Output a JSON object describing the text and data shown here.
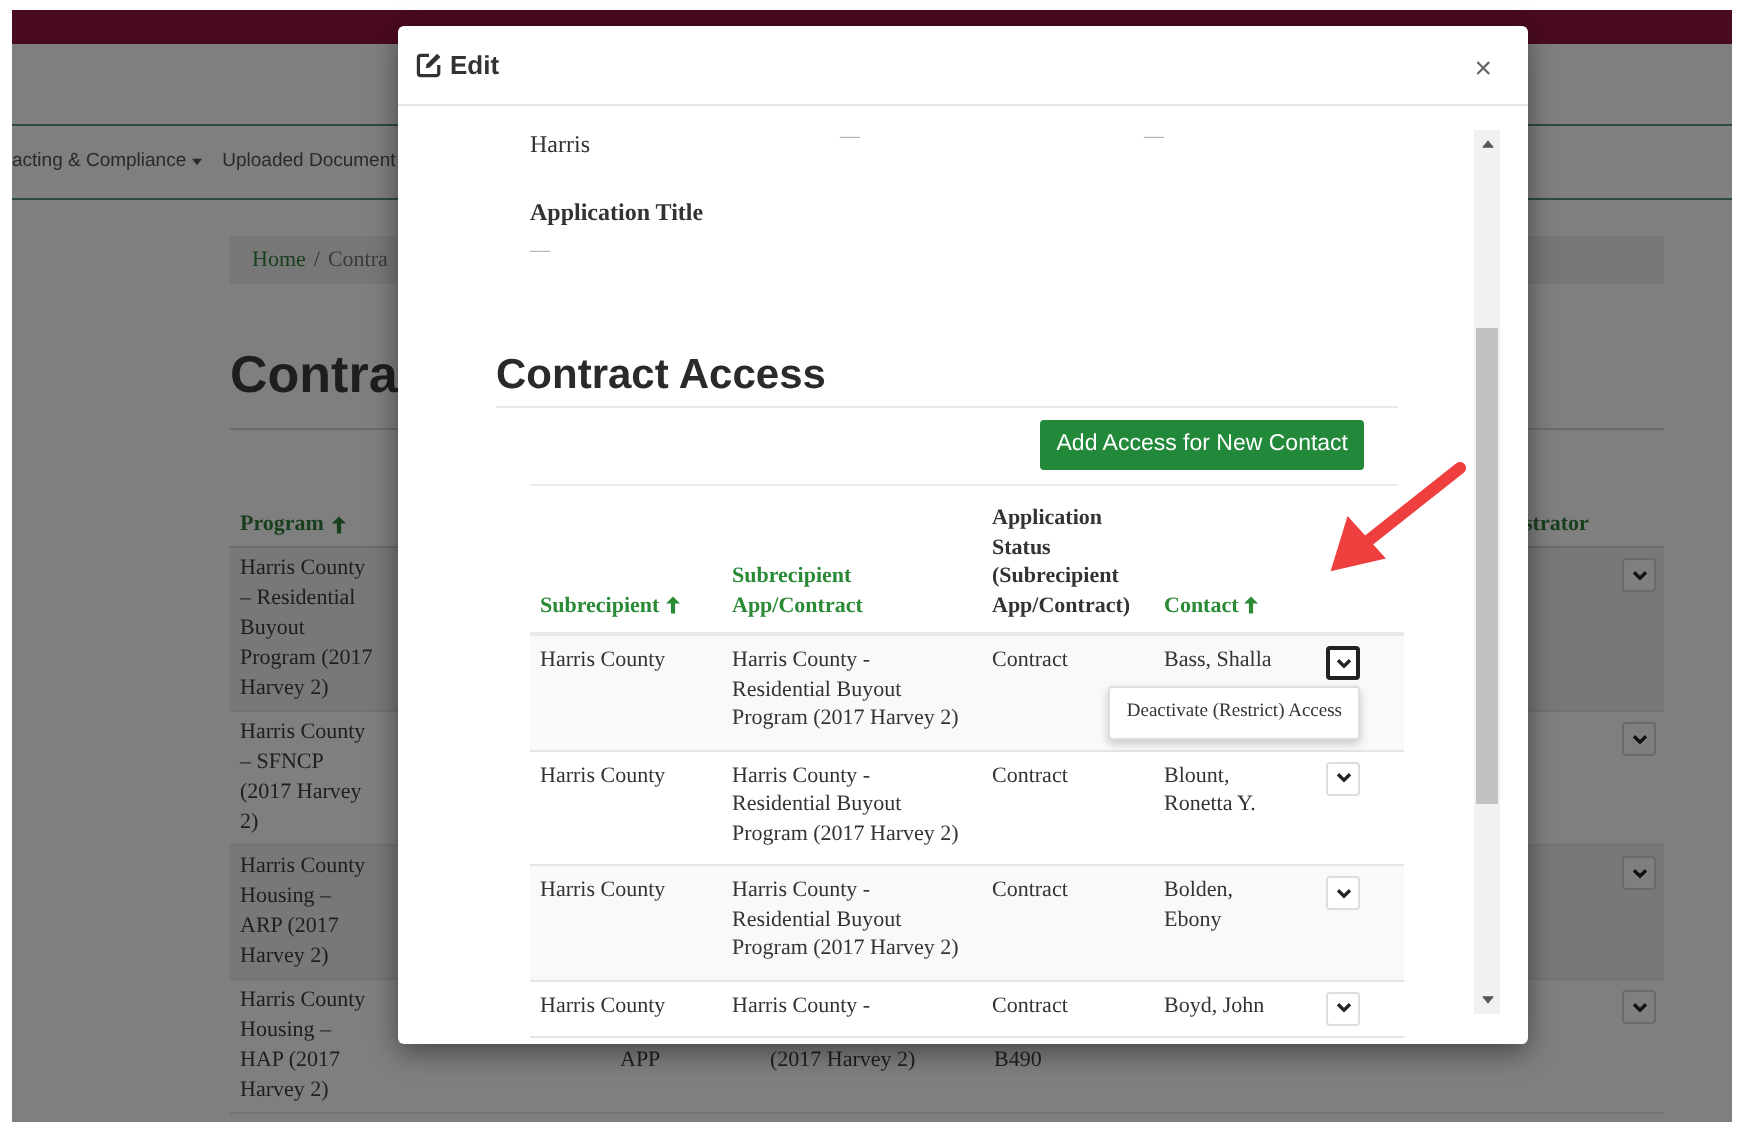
{
  "background_page": {
    "nav_items": [
      {
        "label": "acting & Compliance",
        "dropdown": true
      },
      {
        "label": "Uploaded Document",
        "dropdown": false
      }
    ],
    "breadcrumb": {
      "items": [
        "Home",
        "Contra"
      ],
      "separator": "/"
    },
    "heading": "Contra",
    "table": {
      "columns": [
        {
          "label": "Program",
          "sorted": true
        },
        {
          "label": "strator",
          "sorted": false
        }
      ],
      "rows": [
        {
          "program": "Harris County – Residential Buyout Program (2017 Harvey 2)"
        },
        {
          "program": "Harris County – SFNCP (2017 Harvey 2)"
        },
        {
          "program": "Harris County Housing – ARP (2017 Harvey 2)"
        },
        {
          "program": "Harris County Housing – HAP (2017 Harvey 2)",
          "column_3": "APP",
          "column_4": "(2017 Harvey 2)",
          "column_5": "B490"
        }
      ]
    }
  },
  "modal": {
    "title": "Edit",
    "close": "×",
    "summary_row": [
      "Harris",
      "—",
      "—"
    ],
    "field": {
      "label": "Application Title",
      "value": "—"
    },
    "section_title": "Contract Access",
    "add_button": "Add Access for New Contact",
    "table": {
      "columns": [
        {
          "label": "Subrecipient",
          "kind": "link",
          "sorted": true
        },
        {
          "label": "Subrecipient App/Contract",
          "kind": "link",
          "sorted": false
        },
        {
          "label": "Application Status (Subrecipient App/Contract)",
          "kind": "plain",
          "sorted": false
        },
        {
          "label": "Contact",
          "kind": "link",
          "sorted": true
        }
      ],
      "rows": [
        {
          "subrecipient": "Harris County",
          "app_contract": "Harris County - Residential Buyout Program (2017 Harvey 2)",
          "status": "Contract",
          "contact": "Bass, Shalla",
          "menu_open": true
        },
        {
          "subrecipient": "Harris County",
          "app_contract": "Harris County - Residential Buyout Program (2017 Harvey 2)",
          "status": "Contract",
          "contact": "Blount, Ronetta Y.",
          "menu_open": false
        },
        {
          "subrecipient": "Harris County",
          "app_contract": "Harris County - Residential Buyout Program (2017 Harvey 2)",
          "status": "Contract",
          "contact": "Bolden, Ebony",
          "menu_open": false
        },
        {
          "subrecipient": "Harris County",
          "app_contract": "Harris County -",
          "status": "Contract",
          "contact": "Boyd, John",
          "menu_open": false
        }
      ]
    },
    "menu_item": "Deactivate (Restrict) Access"
  }
}
